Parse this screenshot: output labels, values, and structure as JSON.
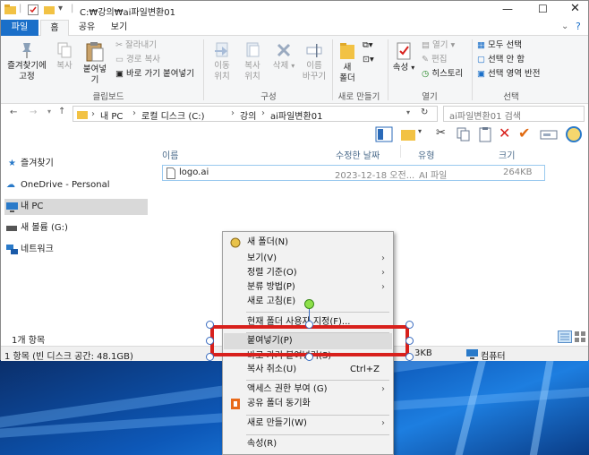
{
  "window": {
    "path_title": "C:₩강의₩ai파일변환01"
  },
  "tabs": [
    {
      "label": "파일"
    },
    {
      "label": "홈"
    },
    {
      "label": "공유"
    },
    {
      "label": "보기"
    }
  ],
  "ribbon": {
    "pin_label": "즐겨찾기에\n고정",
    "copy_label": "복사",
    "paste_label": "붙여넣기",
    "cut_label": "잘라내기",
    "copy_path_label": "경로 복사",
    "paste_shortcut_label": "바로 가기 붙여넣기",
    "clipboard_group": "클립보드",
    "move_to_label": "이동\n위치",
    "copy_to_label": "복사\n위치",
    "delete_label": "삭제",
    "rename_label": "이름\n바꾸기",
    "organize_group": "구성",
    "new_folder_label": "새\n폴더",
    "new_group": "새로 만들기",
    "properties_label": "속성",
    "open_label": "열기",
    "edit_label": "편집",
    "history_label": "히스토리",
    "open_group": "열기",
    "select_all_label": "모두 선택",
    "select_none_label": "선택 안 함",
    "invert_selection_label": "선택 영역 반전",
    "select_group": "선택"
  },
  "address": {
    "crumbs": [
      "내 PC",
      "로컬 디스크 (C:)",
      "강의",
      "ai파일변환01"
    ],
    "search_placeholder": "ai파일변환01 검색"
  },
  "nav": {
    "items": [
      {
        "label": "즐겨찾기"
      },
      {
        "label": "OneDrive - Personal"
      },
      {
        "label": "내 PC"
      },
      {
        "label": "새 볼륨 (G:)"
      },
      {
        "label": "네트워크"
      }
    ]
  },
  "columns": {
    "name": "이름",
    "modified": "수정한 날짜",
    "type": "유형",
    "size": "크기"
  },
  "files": [
    {
      "name": "logo.ai",
      "modified": "2023-12-18 오전...",
      "type": "AI 파일",
      "size": "264KB"
    }
  ],
  "status": {
    "item_count": "1개 항목",
    "bottom_left": "1 항목 (빈 디스크 공간: 48.1GB)",
    "bottom_size": "3KB",
    "bottom_right": "컴퓨터"
  },
  "context_menu": {
    "items": [
      {
        "label": "새 폴더(N)"
      },
      {
        "label": "보기(V)"
      },
      {
        "label": "정렬 기준(O)"
      },
      {
        "label": "분류 방법(P)"
      },
      {
        "label": "새로 고침(E)"
      },
      {
        "label": "현재 폴더 사용자 지정(F)..."
      },
      {
        "label": "붙여넣기(P)"
      },
      {
        "label": "바로 가기 붙여넣기(S)"
      },
      {
        "label": "복사 취소(U)",
        "shortcut": "Ctrl+Z"
      },
      {
        "label": "액세스 권한 부여 (G)"
      },
      {
        "label": "공유 폴더 동기화"
      },
      {
        "label": "새로 만들기(W)"
      },
      {
        "label": "속성(R)"
      }
    ]
  },
  "colors": {
    "accent": "#1a6fc9",
    "highlight": "#d8201c",
    "menu_bg": "#f2f2f2"
  }
}
